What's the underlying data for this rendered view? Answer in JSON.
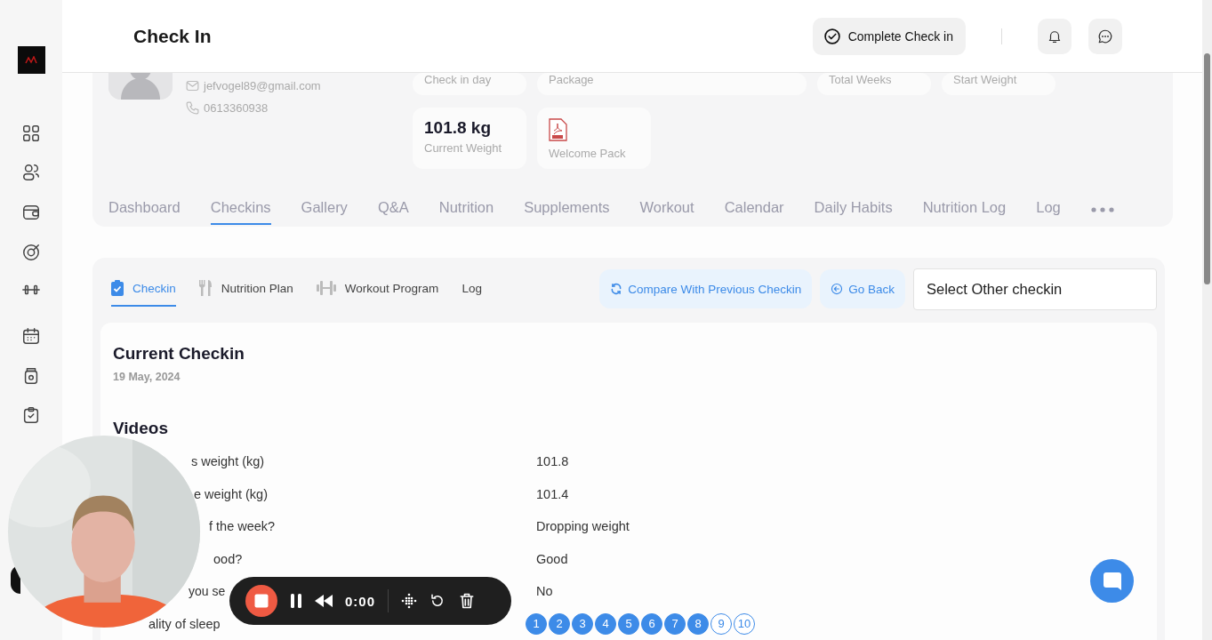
{
  "header": {
    "title": "Check In",
    "complete_button": "Complete Check in"
  },
  "profile": {
    "email": "jefvogel89@gmail.com",
    "phone": "0613360938"
  },
  "stats": [
    {
      "kind": "stat",
      "label": "Check in day"
    },
    {
      "kind": "stat",
      "label": "Package"
    },
    {
      "kind": "stat",
      "label": "Total Weeks"
    },
    {
      "kind": "stat",
      "label": "Start Weight"
    },
    {
      "kind": "stat",
      "value": "101.8 kg",
      "label": "Current Weight"
    },
    {
      "kind": "file",
      "label": "Welcome Pack"
    }
  ],
  "main_tabs": [
    {
      "label": "Dashboard",
      "selected": false
    },
    {
      "label": "Checkins",
      "selected": true
    },
    {
      "label": "Gallery",
      "selected": false
    },
    {
      "label": "Q&A",
      "selected": false
    },
    {
      "label": "Nutrition",
      "selected": false
    },
    {
      "label": "Supplements",
      "selected": false
    },
    {
      "label": "Workout",
      "selected": false
    },
    {
      "label": "Calendar",
      "selected": false
    },
    {
      "label": "Daily Habits",
      "selected": false
    },
    {
      "label": "Nutrition Log",
      "selected": false
    },
    {
      "label": "Log",
      "selected": false
    }
  ],
  "sub_tabs": [
    {
      "kind": "clipboard",
      "label": "Checkin",
      "selected": true
    },
    {
      "kind": "cutlery",
      "label": "Nutrition Plan",
      "selected": false
    },
    {
      "kind": "dumbbell",
      "label": "Workout Program",
      "selected": false
    },
    {
      "kind": "plain",
      "label": "Log",
      "selected": false
    }
  ],
  "actions": {
    "compare": "Compare With Previous Checkin",
    "go_back": "Go Back",
    "select": {
      "value": "Select Other checkin"
    }
  },
  "checkin": {
    "title": "Current Checkin",
    "date": "19 May, 2024",
    "section": "Videos",
    "rows": [
      {
        "kind": "text",
        "question": "s weight (kg)",
        "answer": "101.8"
      },
      {
        "kind": "text",
        "question": "e weight (kg)",
        "answer": "101.4"
      },
      {
        "kind": "text",
        "question": "f the week?",
        "answer": "Dropping weight"
      },
      {
        "kind": "text",
        "question": "ood?",
        "answer": "Good"
      },
      {
        "kind": "text",
        "question": "you se",
        "answer": "No"
      },
      {
        "kind": "rating",
        "question": "ality of sleep",
        "options": [
          {
            "label": "1",
            "filled": true
          },
          {
            "label": "2",
            "filled": true
          },
          {
            "label": "3",
            "filled": true
          },
          {
            "label": "4",
            "filled": true
          },
          {
            "label": "5",
            "filled": true
          },
          {
            "label": "6",
            "filled": true
          },
          {
            "label": "7",
            "filled": true
          },
          {
            "label": "8",
            "filled": true
          },
          {
            "label": "9",
            "filled": false
          },
          {
            "label": "10",
            "filled": false
          }
        ]
      }
    ]
  },
  "recorder": {
    "time": "0:00"
  }
}
